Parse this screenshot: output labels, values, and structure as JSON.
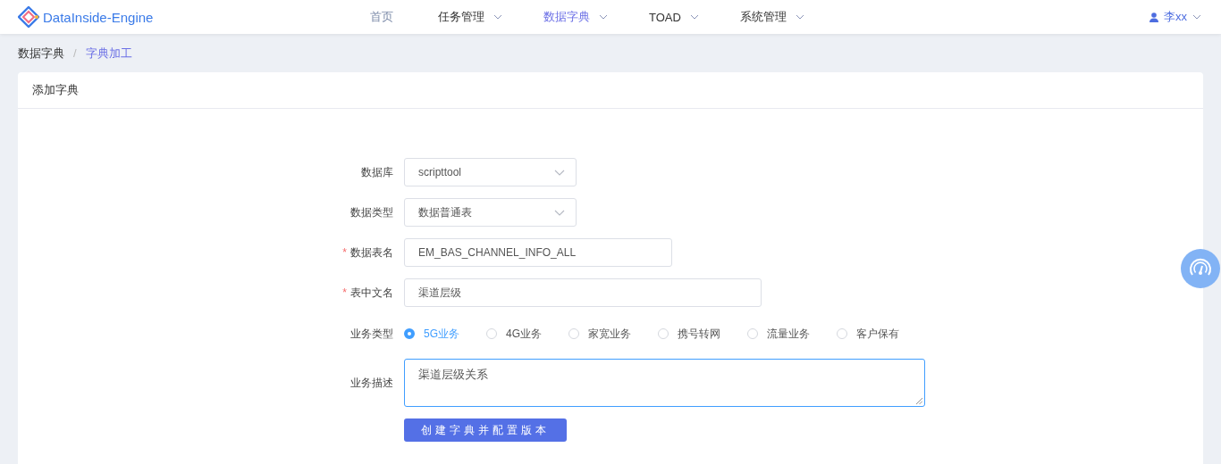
{
  "header": {
    "logo": "DataInside-Engine",
    "nav": [
      {
        "label": "首页",
        "selected": false,
        "dropdown": false
      },
      {
        "label": "任务管理",
        "selected": false,
        "dropdown": true
      },
      {
        "label": "数据字典",
        "selected": true,
        "dropdown": true
      },
      {
        "label": "TOAD",
        "selected": false,
        "dropdown": true
      },
      {
        "label": "系统管理",
        "selected": false,
        "dropdown": true
      }
    ],
    "user": "李xx"
  },
  "breadcrumb": [
    "数据字典",
    "字典加工"
  ],
  "breadcrumb_separator": "/",
  "required_mark": "*",
  "card": {
    "title": "添加字典"
  },
  "form": {
    "fields": [
      {
        "kind": "select",
        "label": "数据库",
        "required": false,
        "value": "scripttool"
      },
      {
        "kind": "select",
        "label": "数据类型",
        "required": false,
        "value": "数据普通表"
      },
      {
        "kind": "input",
        "label": "数据表名",
        "required": true,
        "value": "EM_BAS_CHANNEL_INFO_ALL"
      },
      {
        "kind": "input",
        "label": "表中文名",
        "required": true,
        "value": "渠道层级"
      },
      {
        "kind": "radio",
        "label": "业务类型",
        "required": false,
        "options": [
          {
            "label": "5G业务",
            "selected": true
          },
          {
            "label": "4G业务",
            "selected": false
          },
          {
            "label": "家宽业务",
            "selected": false
          },
          {
            "label": "携号转网",
            "selected": false
          },
          {
            "label": "流量业务",
            "selected": false
          },
          {
            "label": "客户保有",
            "selected": false
          }
        ]
      },
      {
        "kind": "textarea",
        "label": "业务描述",
        "required": false,
        "value": "渠道层级关系"
      }
    ],
    "submit": "创建字典并配置版本"
  }
}
